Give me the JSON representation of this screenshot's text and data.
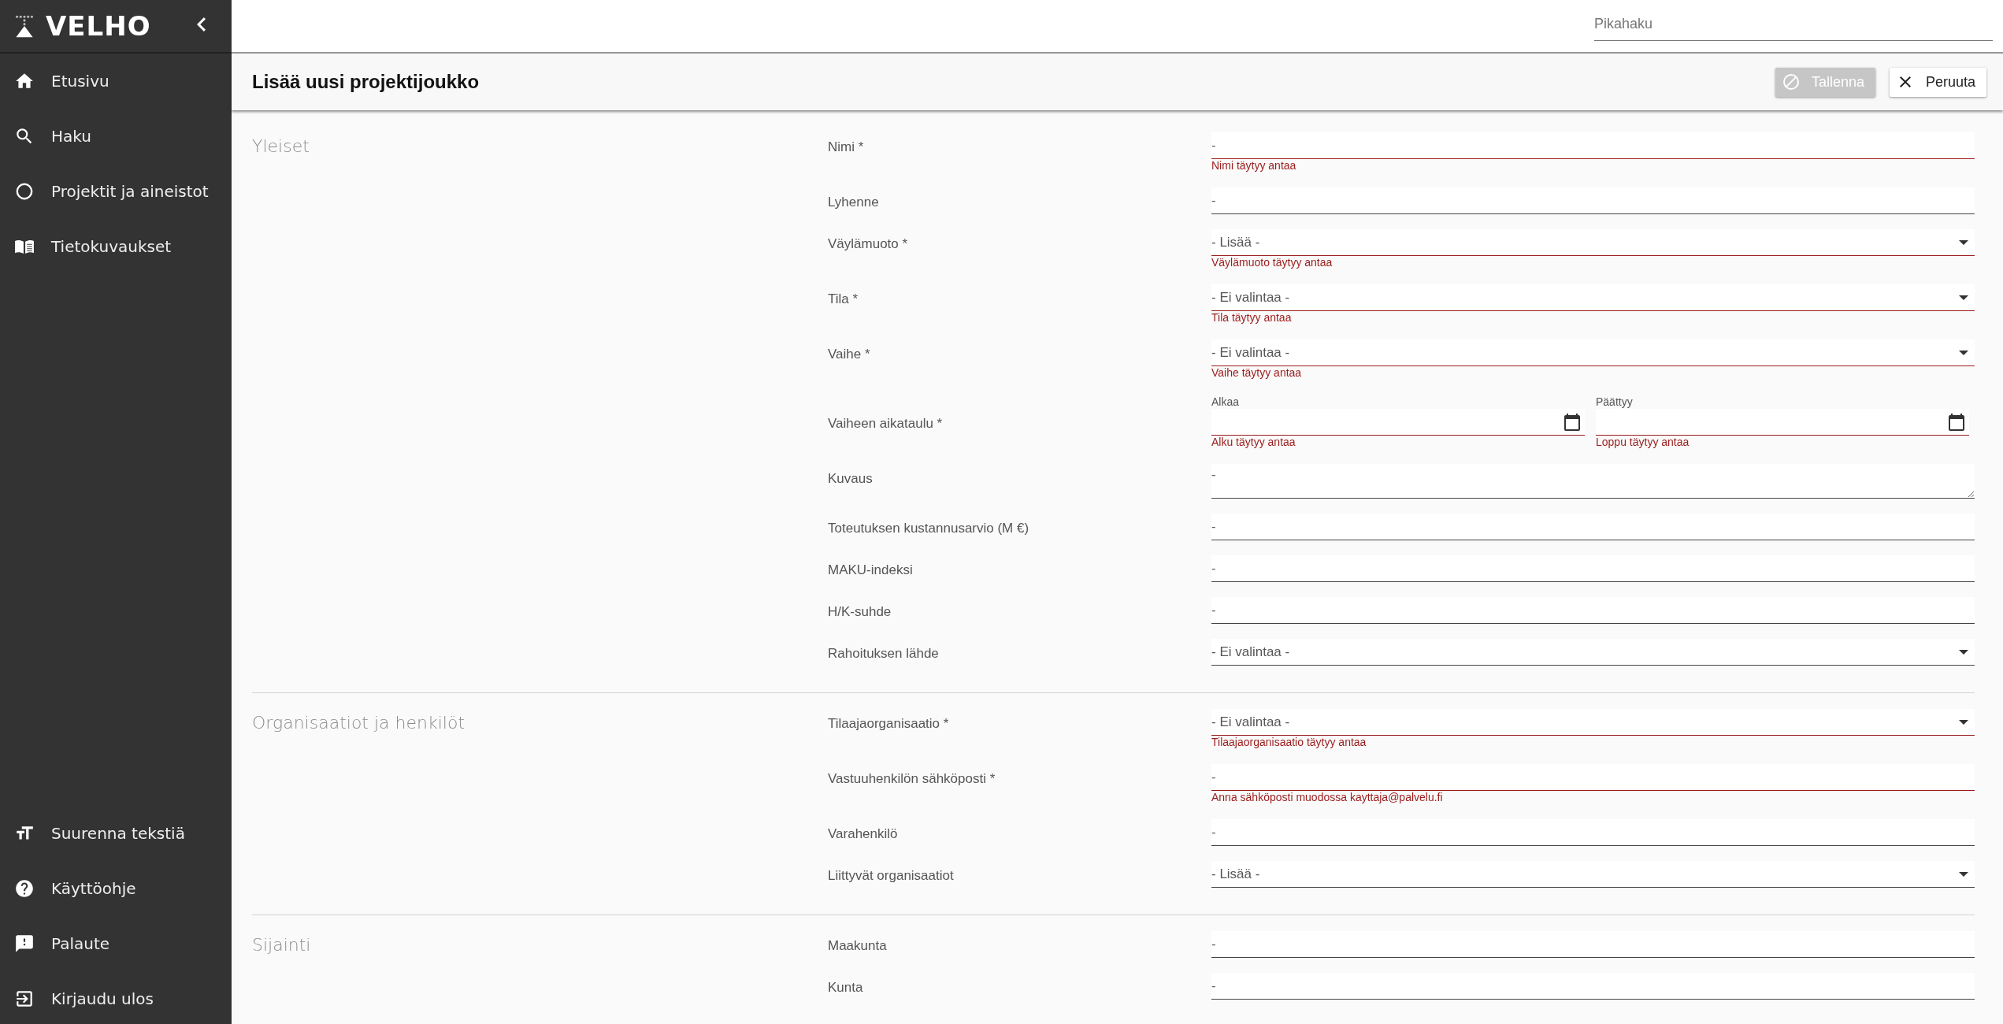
{
  "app": {
    "logo": "VELHO"
  },
  "sidebar": {
    "items": [
      {
        "label": "Etusivu"
      },
      {
        "label": "Haku"
      },
      {
        "label": "Projektit ja aineistot"
      },
      {
        "label": "Tietokuvaukset"
      }
    ],
    "bottom_items": [
      {
        "label": "Suurenna tekstiä"
      },
      {
        "label": "Käyttöohje"
      },
      {
        "label": "Palaute"
      },
      {
        "label": "Kirjaudu ulos"
      }
    ]
  },
  "search": {
    "placeholder": "Pikahaku"
  },
  "header": {
    "title": "Lisää uusi projektijoukko"
  },
  "buttons": [
    {
      "label": "Tallenna",
      "kind": "save",
      "disabled": true
    },
    {
      "label": "Peruuta",
      "kind": "cancel",
      "disabled": false
    }
  ],
  "sections": [
    {
      "title": "Yleiset",
      "fields": [
        {
          "label": "Nimi *",
          "kind": "text",
          "placeholder": "-",
          "error": "Nimi täytyy antaa"
        },
        {
          "label": "Lyhenne",
          "kind": "text",
          "placeholder": "-"
        },
        {
          "label": "Väylämuoto *",
          "kind": "select",
          "value": "- Lisää -",
          "error": "Väylämuoto täytyy antaa"
        },
        {
          "label": "Tila *",
          "kind": "select",
          "value": "- Ei valintaa -",
          "error": "Tila täytyy antaa"
        },
        {
          "label": "Vaihe *",
          "kind": "select",
          "value": "- Ei valintaa -",
          "error": "Vaihe täytyy antaa"
        },
        {
          "label": "Vaiheen aikataulu *",
          "kind": "daterange",
          "parts": [
            {
              "label": "Alkaa",
              "error": "Alku täytyy antaa"
            },
            {
              "label": "Päättyy",
              "error": "Loppu täytyy antaa"
            }
          ]
        },
        {
          "label": "Kuvaus",
          "kind": "textarea",
          "placeholder": "-"
        },
        {
          "label": "Toteutuksen kustannusarvio (M €)",
          "kind": "text",
          "placeholder": "-"
        },
        {
          "label": "MAKU-indeksi",
          "kind": "text",
          "placeholder": "-"
        },
        {
          "label": "H/K-suhde",
          "kind": "text",
          "placeholder": "-"
        },
        {
          "label": "Rahoituksen lähde",
          "kind": "select",
          "value": "- Ei valintaa -"
        }
      ]
    },
    {
      "title": "Organisaatiot ja henkilöt",
      "fields": [
        {
          "label": "Tilaajaorganisaatio *",
          "kind": "select",
          "value": "- Ei valintaa -",
          "error": "Tilaajaorganisaatio täytyy antaa"
        },
        {
          "label": "Vastuuhenkilön sähköposti *",
          "kind": "text",
          "placeholder": "-",
          "error": "Anna sähköposti muodossa kayttaja@palvelu.fi"
        },
        {
          "label": "Varahenkilö",
          "kind": "text",
          "placeholder": "-"
        },
        {
          "label": "Liittyvät organisaatiot",
          "kind": "select",
          "value": "- Lisää -"
        }
      ]
    },
    {
      "title": "Sijainti",
      "fields": [
        {
          "label": "Maakunta",
          "kind": "text",
          "placeholder": "-"
        },
        {
          "label": "Kunta",
          "kind": "text",
          "placeholder": "-"
        }
      ]
    }
  ]
}
